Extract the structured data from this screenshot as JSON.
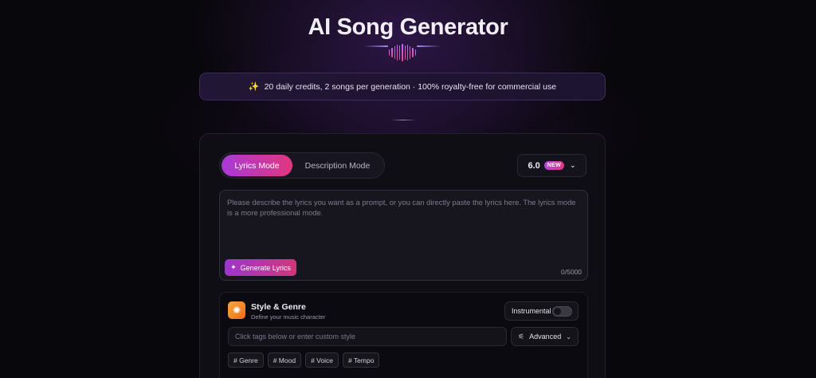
{
  "header": {
    "title": "AI Song Generator"
  },
  "banner": {
    "icon": "sparkles-icon",
    "text": "20 daily credits, 2 songs per generation · 100% royalty-free for commercial use"
  },
  "modes": {
    "active_label": "Lyrics Mode",
    "inactive_label": "Description Mode"
  },
  "model_select": {
    "version": "6.0",
    "badge": "NEW"
  },
  "lyrics": {
    "placeholder": "Please describe the lyrics you want as a prompt, or you can directly paste the lyrics here. The lyrics mode is a more professional mode.",
    "generate_label": "Generate Lyrics",
    "counter": "0/5000"
  },
  "style": {
    "title": "Style & Genre",
    "subtitle": "Define your music character",
    "instrumental_label": "Instrumental",
    "instrumental_on": false,
    "input_placeholder": "Click tags below or enter custom style",
    "advanced_label": "Advanced",
    "tags": [
      "# Genre",
      "# Mood",
      "# Voice",
      "# Tempo"
    ]
  },
  "colors": {
    "accent_start": "#a83ad8",
    "accent_end": "#e1377e",
    "style_icon": "#f7a83a"
  }
}
